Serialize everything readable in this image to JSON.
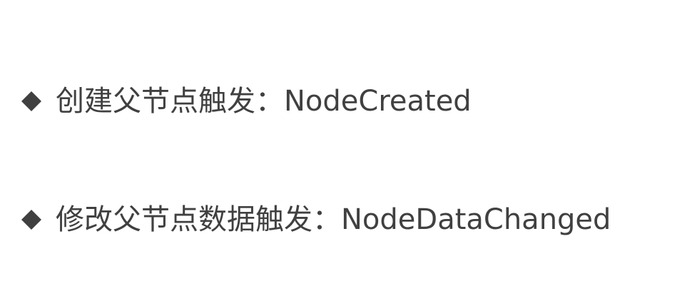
{
  "bullets": [
    {
      "icon": "diamond-bullet-icon",
      "text": "创建父节点触发：NodeCreated"
    },
    {
      "icon": "diamond-bullet-icon",
      "text": "修改父节点数据触发：NodeDataChanged"
    }
  ],
  "colors": {
    "text": "#404040",
    "bullet": "#404040",
    "background": "#ffffff"
  }
}
